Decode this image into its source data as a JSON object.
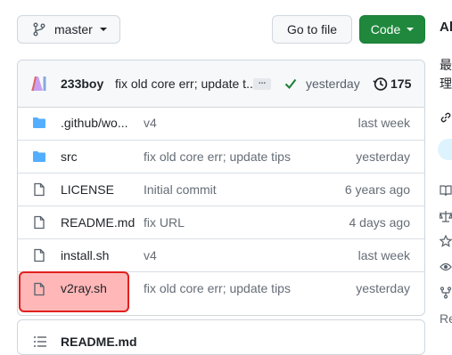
{
  "toolbar": {
    "branch_label": "master",
    "go_to_file_label": "Go to file",
    "code_label": "Code"
  },
  "commit": {
    "author": "233boy",
    "message": "fix old core err; update t...",
    "ellipsis": "...",
    "time": "yesterday",
    "count": "175",
    "status_color": "#1a7f37"
  },
  "files": [
    {
      "name": ".github/wo...",
      "message": "v4",
      "time": "last week",
      "type": "folder"
    },
    {
      "name": "src",
      "message": "fix old core err; update tips",
      "time": "yesterday",
      "type": "folder"
    },
    {
      "name": "LICENSE",
      "message": "Initial commit",
      "time": "6 years ago",
      "type": "file"
    },
    {
      "name": "README.md",
      "message": "fix URL",
      "time": "4 days ago",
      "type": "file"
    },
    {
      "name": "install.sh",
      "message": "v4",
      "time": "last week",
      "type": "file"
    },
    {
      "name": "v2ray.sh",
      "message": "fix old core err; update tips",
      "time": "yesterday",
      "type": "file"
    }
  ],
  "readme": {
    "title": "README.md"
  },
  "sidebar": {
    "about": "Al",
    "desc_line1": "最",
    "desc_line2": "理",
    "cut_text": "Re"
  },
  "colors": {
    "folder": "#54aeff",
    "primary_button": "#1f883d",
    "highlight_border": "#e02020"
  }
}
